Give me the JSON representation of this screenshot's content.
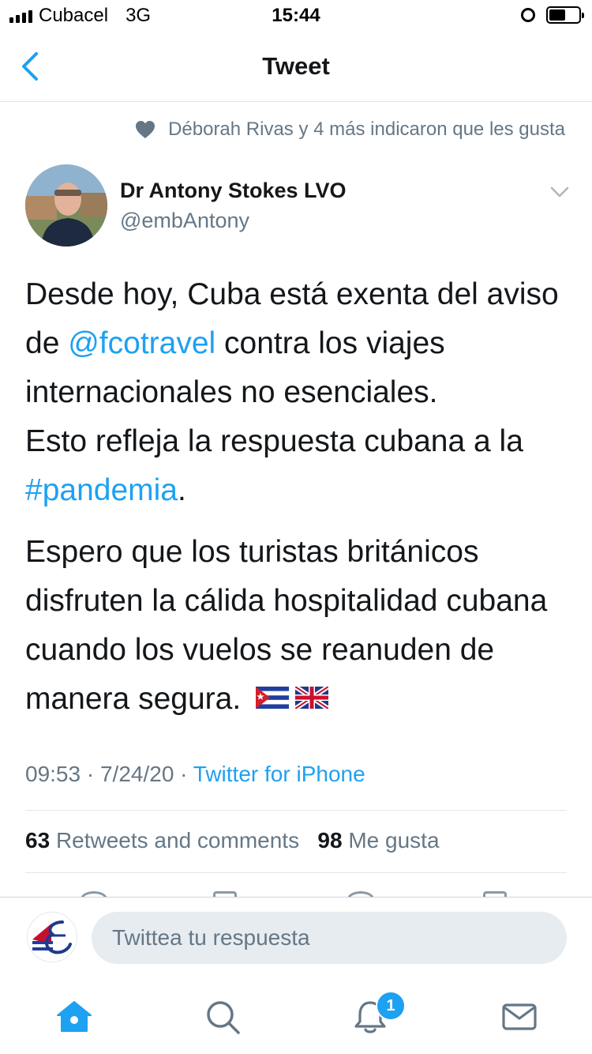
{
  "status_bar": {
    "carrier": "Cubacel",
    "network": "3G",
    "time": "15:44"
  },
  "nav": {
    "title": "Tweet"
  },
  "social_context": {
    "text": "Déborah Rivas y 4 más indicaron que les gusta"
  },
  "author": {
    "name": "Dr Antony Stokes LVO",
    "handle": "@embAntony"
  },
  "tweet": {
    "p1_a": "Desde hoy, Cuba está exenta del aviso de ",
    "mention": "@fcotravel",
    "p1_b": " contra los viajes internacionales no esenciales.",
    "p1_c": "Esto refleja la respuesta cubana a la ",
    "hashtag": "#pandemia",
    "p1_d": ".",
    "p2": "Espero que los turistas británicos disfruten la cálida hospitalidad cubana cuando los vuelos se reanuden de manera segura.",
    "flags": [
      "cuba-flag",
      "uk-flag"
    ]
  },
  "meta": {
    "time": "09:53",
    "sep1": " · ",
    "date": "7/24/20",
    "sep2": " · ",
    "source": "Twitter for iPhone"
  },
  "stats": {
    "retweets_count": "63",
    "retweets_label": "Retweets and comments",
    "likes_count": "98",
    "likes_label": "Me gusta"
  },
  "reply": {
    "placeholder": "Twittea tu respuesta"
  },
  "tabbar": {
    "notifications_badge": "1"
  },
  "colors": {
    "accent": "#1da1f2",
    "secondary_text": "#657786",
    "primary_text": "#14171a"
  }
}
